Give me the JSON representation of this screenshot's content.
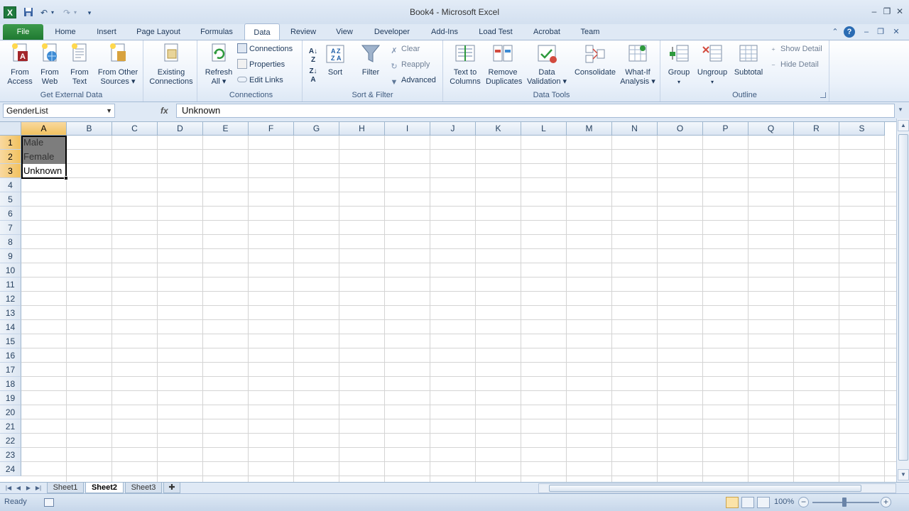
{
  "window": {
    "title": "Book4 - Microsoft Excel"
  },
  "tabs": {
    "file": "File",
    "items": [
      "Home",
      "Insert",
      "Page Layout",
      "Formulas",
      "Data",
      "Review",
      "View",
      "Developer",
      "Add-Ins",
      "Load Test",
      "Acrobat",
      "Team"
    ],
    "active": "Data"
  },
  "ribbon": {
    "get_external": {
      "label": "Get External Data",
      "from_access": [
        "From",
        "Access"
      ],
      "from_web": [
        "From",
        "Web"
      ],
      "from_text": [
        "From",
        "Text"
      ],
      "from_other": [
        "From Other",
        "Sources ▾"
      ],
      "existing": [
        "Existing",
        "Connections"
      ]
    },
    "connections": {
      "label": "Connections",
      "refresh_all": [
        "Refresh",
        "All ▾"
      ],
      "connections": "Connections",
      "properties": "Properties",
      "edit_links": "Edit Links"
    },
    "sort_filter": {
      "label": "Sort & Filter",
      "sort": "Sort",
      "filter": "Filter",
      "clear": "Clear",
      "reapply": "Reapply",
      "advanced": "Advanced"
    },
    "data_tools": {
      "label": "Data Tools",
      "text_to_columns": [
        "Text to",
        "Columns"
      ],
      "remove_duplicates": [
        "Remove",
        "Duplicates"
      ],
      "data_validation": [
        "Data",
        "Validation ▾"
      ],
      "consolidate": "Consolidate",
      "what_if": [
        "What-If",
        "Analysis ▾"
      ]
    },
    "outline": {
      "label": "Outline",
      "group": "Group",
      "ungroup": "Ungroup",
      "subtotal": "Subtotal",
      "show_detail": "Show Detail",
      "hide_detail": "Hide Detail"
    }
  },
  "formula_bar": {
    "name_box": "GenderList",
    "formula": "Unknown",
    "fx": "fx"
  },
  "grid": {
    "columns": [
      "A",
      "B",
      "C",
      "D",
      "E",
      "F",
      "G",
      "H",
      "I",
      "J",
      "K",
      "L",
      "M",
      "N",
      "O",
      "P",
      "Q",
      "R",
      "S"
    ],
    "rows": [
      "1",
      "2",
      "3",
      "4",
      "5",
      "6",
      "7",
      "8",
      "9",
      "10",
      "11",
      "12",
      "13",
      "14",
      "15",
      "16",
      "17",
      "18",
      "19",
      "20",
      "21",
      "22",
      "23",
      "24"
    ],
    "cells": {
      "A1": "Male",
      "A2": "Female",
      "A3": "Unknown"
    }
  },
  "sheets": {
    "items": [
      "Sheet1",
      "Sheet2",
      "Sheet3"
    ],
    "active": "Sheet2"
  },
  "status": {
    "mode": "Ready",
    "zoom": "100%"
  },
  "colors": {
    "file_tab": "#1f7a31",
    "selection_header": "#f1c15f",
    "selected_fill": "#7d7d7d"
  }
}
